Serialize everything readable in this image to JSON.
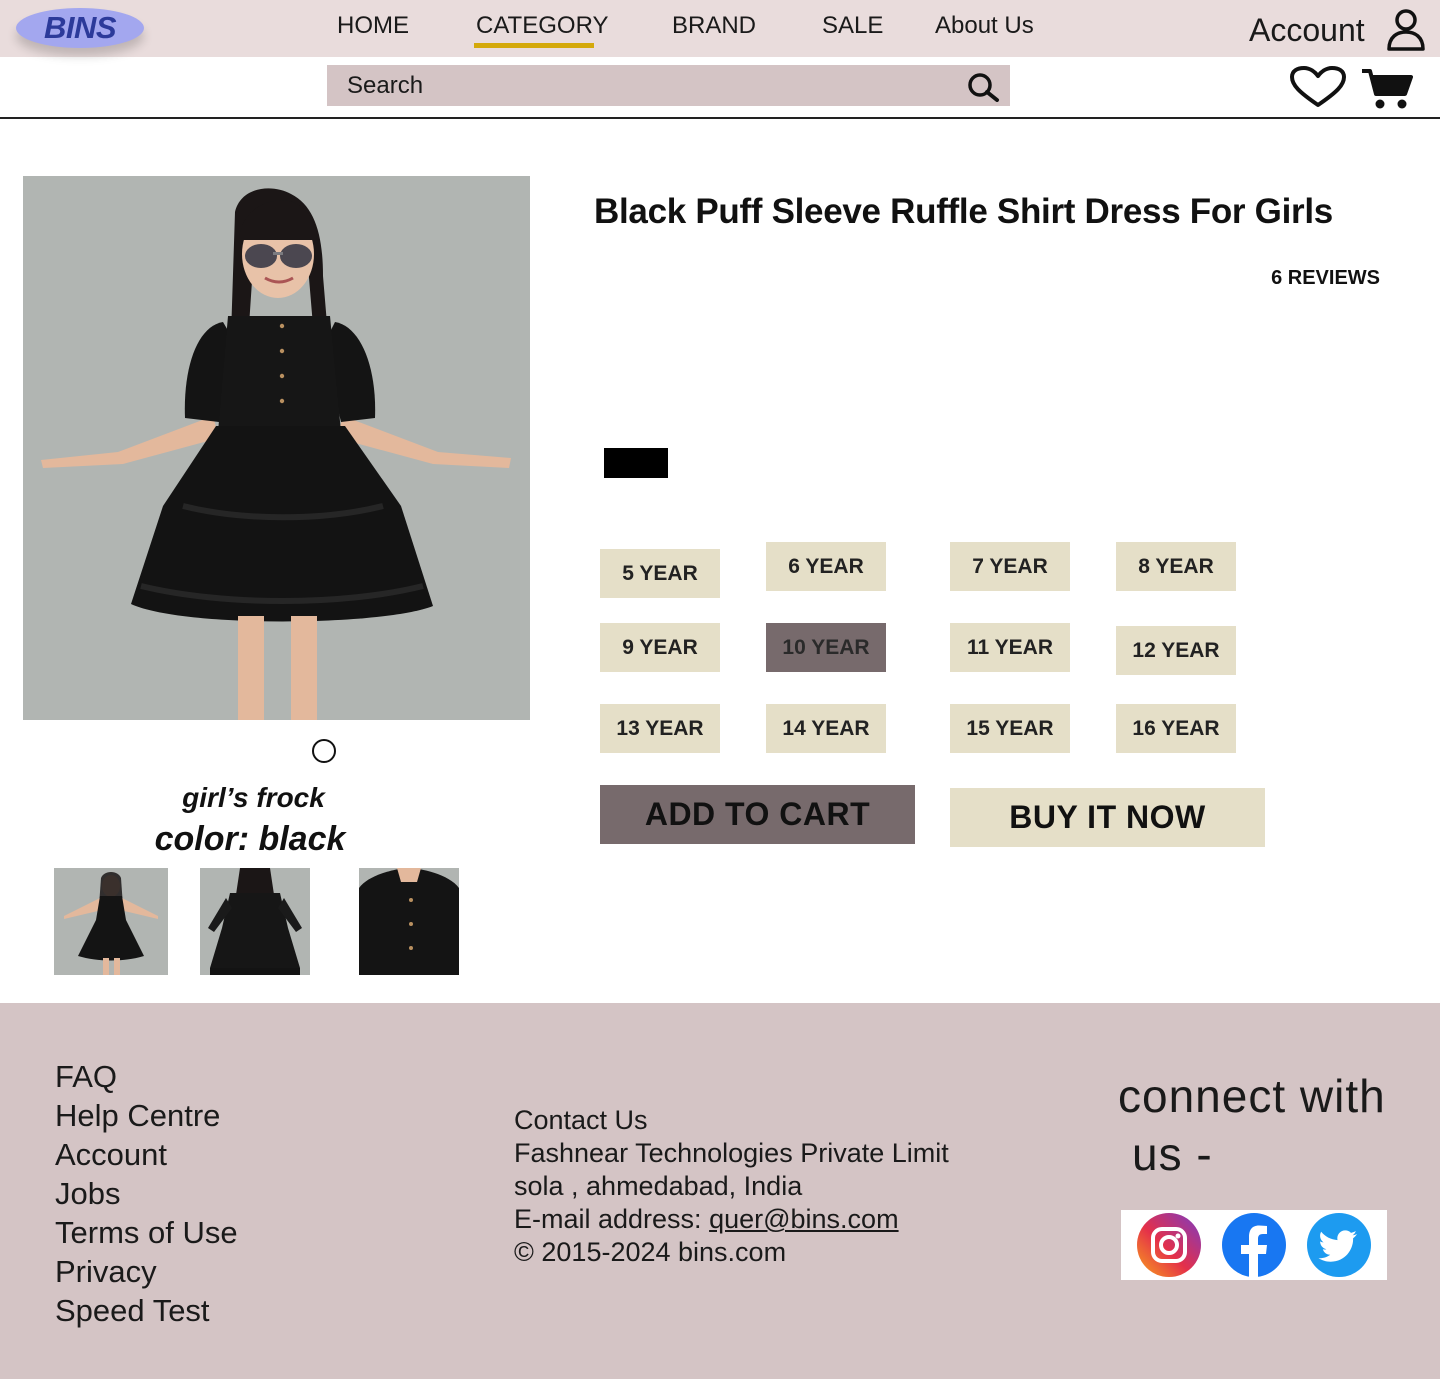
{
  "brand": {
    "logo_text": "BINS"
  },
  "nav": {
    "items": [
      {
        "label": "HOME"
      },
      {
        "label": "CATEGORY"
      },
      {
        "label": "BRAND"
      },
      {
        "label": "SALE"
      },
      {
        "label": "About Us"
      }
    ],
    "active": "CATEGORY",
    "account_label": "Account"
  },
  "search": {
    "placeholder": "Search"
  },
  "product": {
    "title": "Black Puff Sleeve Ruffle Shirt Dress For Girls",
    "reviews": "6 REVIEWS",
    "caption_type": "girl’s frock",
    "caption_color": "color: black",
    "swatch_color": "#000000",
    "sizes": [
      {
        "label": "5 YEAR"
      },
      {
        "label": "6 YEAR"
      },
      {
        "label": "7 YEAR"
      },
      {
        "label": "8 YEAR"
      },
      {
        "label": "9 YEAR"
      },
      {
        "label": "10 YEAR",
        "selected": true
      },
      {
        "label": "11 YEAR"
      },
      {
        "label": "12 YEAR"
      },
      {
        "label": "13 YEAR"
      },
      {
        "label": "14 YEAR"
      },
      {
        "label": "15 YEAR"
      },
      {
        "label": "16 YEAR"
      }
    ],
    "add_to_cart_label": "ADD TO CART",
    "buy_now_label": "BUY IT NOW"
  },
  "footer": {
    "links": [
      {
        "label": "FAQ"
      },
      {
        "label": "Help Centre"
      },
      {
        "label": "Account"
      },
      {
        "label": "Jobs"
      },
      {
        "label": "Terms of Use"
      },
      {
        "label": "Privacy"
      },
      {
        "label": "Speed Test"
      }
    ],
    "contact": {
      "heading": "Contact Us",
      "company": "Fashnear Technologies Private Limit",
      "address": "sola , ahmedabad, India",
      "email_label": "E-mail address: ",
      "email": "quer@bins.com",
      "copyright": "© 2015-2024 bins.com"
    },
    "connect_line1": "connect with",
    "connect_line2": "us -",
    "social": [
      "instagram-icon",
      "facebook-icon",
      "twitter-icon"
    ]
  },
  "colors": {
    "nav_bg": "#e9dcdc",
    "accent_underline": "#d4a90b",
    "search_bg": "#d4c4c5",
    "size_bg": "#e5dfc8",
    "selected_bg": "#776a6c",
    "footer_bg": "#d4c4c5",
    "logo_bg": "#a3a7ef"
  }
}
